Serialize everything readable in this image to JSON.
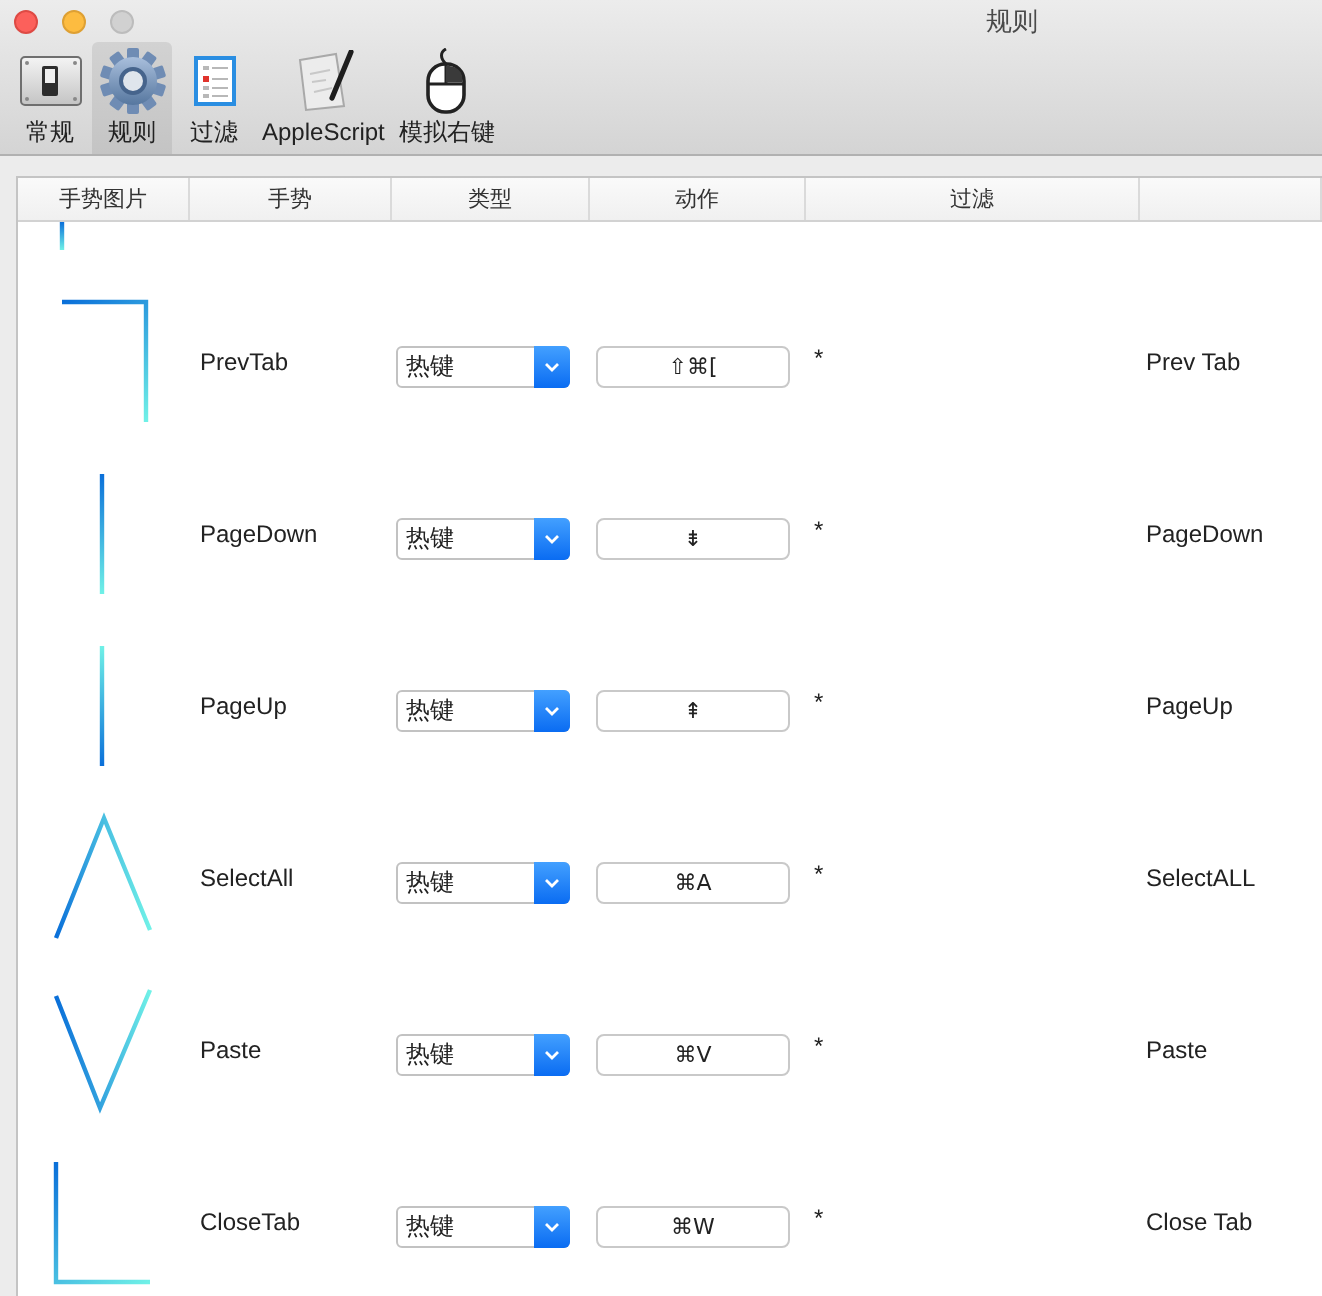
{
  "window": {
    "title": "规则"
  },
  "toolbar": [
    {
      "kind": "switch",
      "label": "常规",
      "selected": false
    },
    {
      "kind": "gear",
      "label": "规则",
      "selected": true
    },
    {
      "kind": "list",
      "label": "过滤",
      "selected": false
    },
    {
      "kind": "script",
      "label": "AppleScript",
      "selected": false
    },
    {
      "kind": "mouse",
      "label": "模拟右键",
      "selected": false
    }
  ],
  "table": {
    "columns": [
      "手势图片",
      "手势",
      "类型",
      "动作",
      "过滤"
    ],
    "rows": [
      {
        "kind": "stub"
      },
      {
        "kind": "hook",
        "gesture": "PrevTab",
        "type": "热键",
        "action": "⇧⌘[",
        "filter": "*",
        "column_6": "Prev Tab"
      },
      {
        "kind": "down",
        "gesture": "PageDown",
        "type": "热键",
        "action": "⇟",
        "filter": "*",
        "column_6": "PageDown"
      },
      {
        "kind": "up",
        "gesture": "PageUp",
        "type": "热键",
        "action": "⇞",
        "filter": "*",
        "column_6": "PageUp"
      },
      {
        "kind": "peak",
        "gesture": "SelectAll",
        "type": "热键",
        "action": "⌘A",
        "filter": "*",
        "column_6": "SelectALL"
      },
      {
        "kind": "valley",
        "gesture": "Paste",
        "type": "热键",
        "action": "⌘V",
        "filter": "*",
        "column_6": "Paste"
      },
      {
        "kind": "corner",
        "gesture": "CloseTab",
        "type": "热键",
        "action": "⌘W",
        "filter": "*",
        "column_6": "Close Tab"
      }
    ]
  }
}
